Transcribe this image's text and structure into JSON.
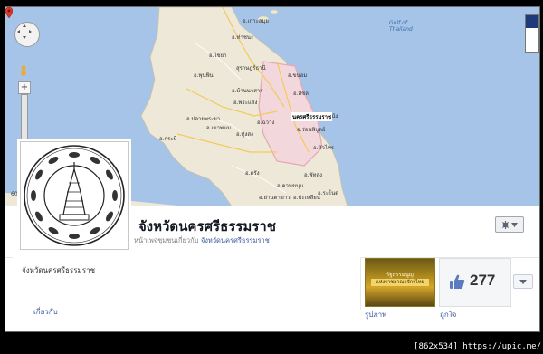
{
  "page": {
    "title": "จังหวัดนครศรีธรรมราช",
    "subtitle_prefix": "หน้าเพจชุมชนเกี่ยวกับ",
    "subtitle_link": "จังหวัดนครศรีธรรมราช"
  },
  "about": {
    "text": "จังหวัดนครศรีธรรมราช",
    "tab_label": "เกี่ยวกับ"
  },
  "photos": {
    "label": "รูปภาพ",
    "tile_line1": "รัฐธรรมนูญ",
    "tile_line2": "แห่งราชอาณาจักรไทย"
  },
  "likes": {
    "count": "277",
    "label": "ถูกใจ"
  },
  "map": {
    "sea_label_1": "Gulf of",
    "sea_label_2": "Thailand",
    "scale": "60",
    "city_label": "นครศรีธรรมราช",
    "labels": [
      "อ.ท่าชนะ",
      "อ.ไชยา",
      "สุราษฎร์ธานี",
      "อ.พุนพิน",
      "อ.บ้านนาสาร",
      "อ.พระแสง",
      "อ.ฉวาง",
      "อ.ทุ่งสง",
      "อ.ร่อนพิบูลย์",
      "อ.ปากพนัง",
      "อ.หัวไทร",
      "อ.พัทลุง",
      "อ.ควนขนุน",
      "อ.ตรัง",
      "อ.สิชล",
      "อ.ขนอม",
      "อ.เกาะสมุย",
      "อ.กระบี่",
      "อ.ปลายพระยา",
      "อ.เขาพนม",
      "อ.ย่านตาขาว",
      "อ.ปะเหลียน",
      "อ.ระโนด"
    ]
  },
  "footer": {
    "credit": "[862x534] https://upic.me/"
  },
  "colors": {
    "sea": "#a6c4e8",
    "land": "#ede8d8",
    "link": "#3b5998",
    "province": "#e7a7b0"
  }
}
